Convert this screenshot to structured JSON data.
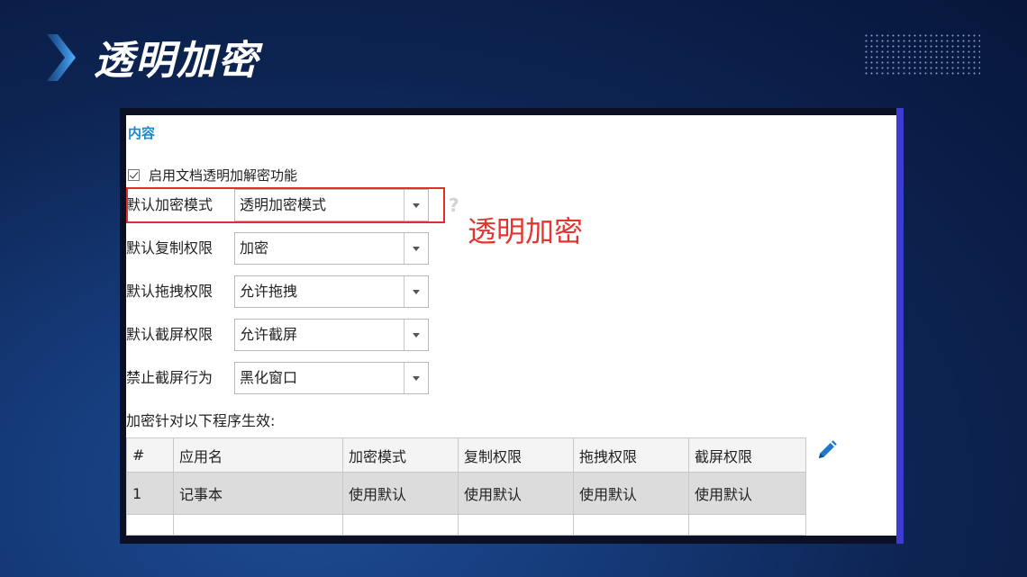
{
  "slide": {
    "title": "透明加密"
  },
  "window": {
    "section_title": "内容",
    "enable_checkbox": {
      "checked": true,
      "label": "启用文档透明加解密功能"
    },
    "settings": [
      {
        "label": "默认加密模式",
        "value": "透明加密模式"
      },
      {
        "label": "默认复制权限",
        "value": "加密"
      },
      {
        "label": "默认拖拽权限",
        "value": "允许拖拽"
      },
      {
        "label": "默认截屏权限",
        "value": "允许截屏"
      },
      {
        "label": "禁止截屏行为",
        "value": "黑化窗口"
      }
    ],
    "help_icon": "?",
    "apply_label": "加密针对以下程序生效:",
    "table": {
      "headers": [
        "#",
        "应用名",
        "加密模式",
        "复制权限",
        "拖拽权限",
        "截屏权限"
      ],
      "rows": [
        [
          "1",
          "记事本",
          "使用默认",
          "使用默认",
          "使用默认",
          "使用默认"
        ]
      ]
    },
    "edit_icon": "pencil-icon"
  },
  "annotation": {
    "text": "透明加密",
    "color": "#e5342f"
  },
  "colors": {
    "accent": "#1e88c9",
    "highlight": "#e0302d",
    "frame_bar": "#3c3cd2"
  }
}
